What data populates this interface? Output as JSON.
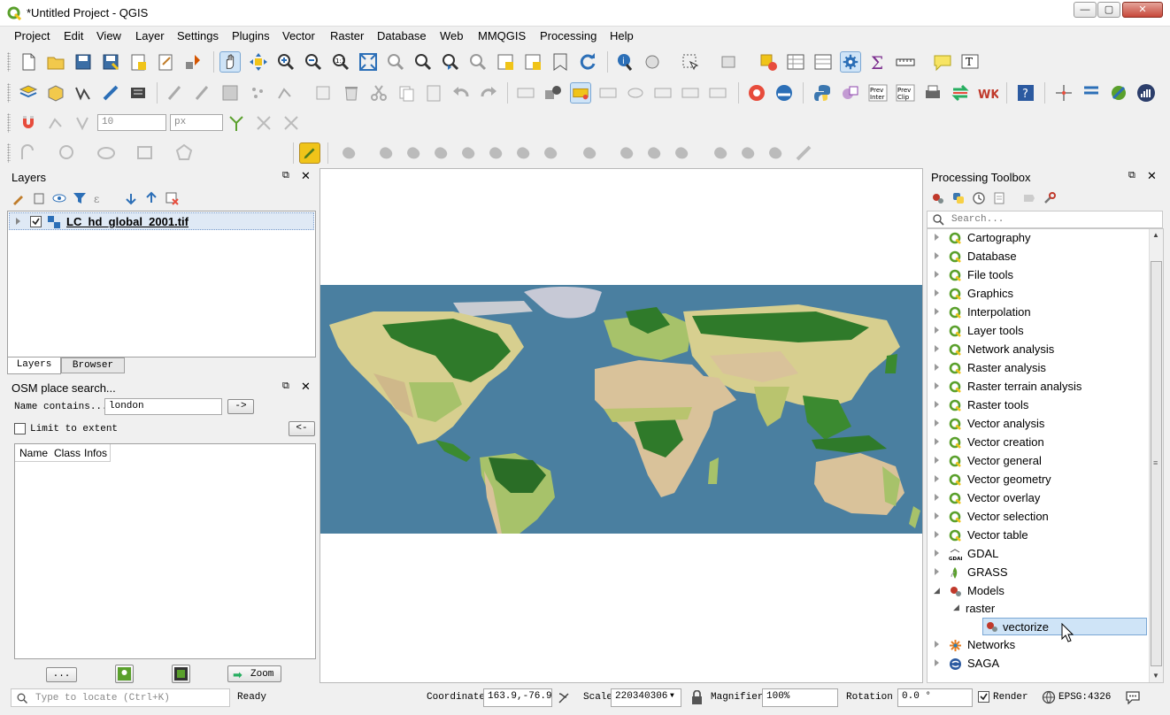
{
  "window": {
    "title": "*Untitled Project - QGIS",
    "minimize": "—",
    "maximize": "▢",
    "close": "✕"
  },
  "menu": [
    "Project",
    "Edit",
    "View",
    "Layer",
    "Settings",
    "Plugins",
    "Vector",
    "Raster",
    "Database",
    "Web",
    "MMQGIS",
    "Processing",
    "Help"
  ],
  "toolbar3": {
    "size_value": "10",
    "unit": "px"
  },
  "layers_panel": {
    "title": "Layers",
    "layer_name": "LC_hd_global_2001.tif",
    "tab_layers": "Layers",
    "tab_browser": "Browser"
  },
  "osm_panel": {
    "title": "OSM place search...",
    "name_contains_label": "Name contains...",
    "name_contains_value": "london",
    "go_button": "->",
    "limit_label": "Limit to extent",
    "back_button": "<-",
    "columns": [
      "Name",
      "Class",
      "Infos"
    ],
    "dots_button": "...",
    "zoom_button": "Zoom"
  },
  "toolbox": {
    "title": "Processing Toolbox",
    "search_placeholder": "Search...",
    "items": [
      {
        "label": "Cartography",
        "icon": "qgis-icon"
      },
      {
        "label": "Database",
        "icon": "qgis-icon"
      },
      {
        "label": "File tools",
        "icon": "qgis-icon"
      },
      {
        "label": "Graphics",
        "icon": "qgis-icon"
      },
      {
        "label": "Interpolation",
        "icon": "qgis-icon"
      },
      {
        "label": "Layer tools",
        "icon": "qgis-icon"
      },
      {
        "label": "Network analysis",
        "icon": "qgis-icon"
      },
      {
        "label": "Raster analysis",
        "icon": "qgis-icon"
      },
      {
        "label": "Raster terrain analysis",
        "icon": "qgis-icon"
      },
      {
        "label": "Raster tools",
        "icon": "qgis-icon"
      },
      {
        "label": "Vector analysis",
        "icon": "qgis-icon"
      },
      {
        "label": "Vector creation",
        "icon": "qgis-icon"
      },
      {
        "label": "Vector general",
        "icon": "qgis-icon"
      },
      {
        "label": "Vector geometry",
        "icon": "qgis-icon"
      },
      {
        "label": "Vector overlay",
        "icon": "qgis-icon"
      },
      {
        "label": "Vector selection",
        "icon": "qgis-icon"
      },
      {
        "label": "Vector table",
        "icon": "qgis-icon"
      },
      {
        "label": "GDAL",
        "icon": "gdal-icon"
      },
      {
        "label": "GRASS",
        "icon": "grass-icon"
      },
      {
        "label": "Models",
        "icon": "models-gear-icon"
      }
    ],
    "models_child": "raster",
    "model_leaf": "vectorize",
    "after_items": [
      {
        "label": "Networks",
        "icon": "networks-icon"
      },
      {
        "label": "SAGA",
        "icon": "saga-icon"
      }
    ]
  },
  "statusbar": {
    "locate_placeholder": "Type to locate (Ctrl+K)",
    "ready": "Ready",
    "coordinate_label": "Coordinate",
    "coordinate_value": "163.9,-76.9",
    "scale_label": "Scale",
    "scale_value": "220340306",
    "magnifier_label": "Magnifier",
    "magnifier_value": "100%",
    "rotation_label": "Rotation",
    "rotation_value": "0.0 °",
    "render_label": "Render",
    "crs": "EPSG:4326"
  },
  "colors": {
    "ocean": "#4a7fa0",
    "forest": "#2f7a2a",
    "grass": "#a7c26a",
    "desert": "#d9c29a",
    "tundra": "#c7c9d6",
    "qgis_green": "#5aa02c",
    "selection": "#cfe4f7"
  }
}
